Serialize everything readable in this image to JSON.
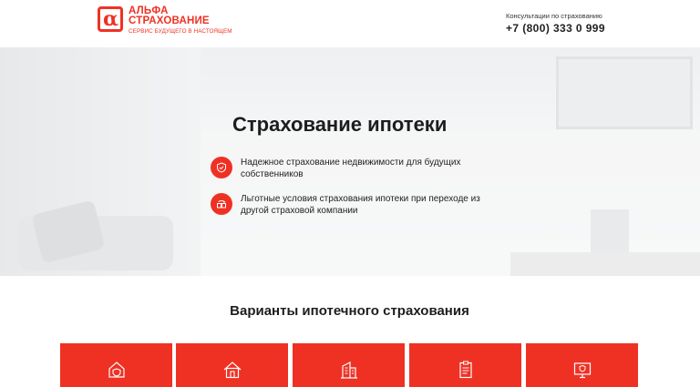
{
  "header": {
    "logo_line1": "АЛЬФА",
    "logo_line2": "СТРАХОВАНИЕ",
    "logo_tagline": "СЕРВИС БУДУЩЕГО В НАСТОЯЩЕМ",
    "contact_label": "Консультации по страхованию",
    "phone": "+7 (800) 333 0 999"
  },
  "hero": {
    "title": "Страхование ипотеки",
    "features": [
      {
        "icon": "shield-icon",
        "text": "Надежное страхование недвижимости для будущих собственников"
      },
      {
        "icon": "transfer-icon",
        "text": "Льготные условия страхования ипотеки при переходе из другой страховой компании"
      }
    ]
  },
  "variants": {
    "title": "Варианты ипотечного страхования",
    "tiles": [
      {
        "icon": "house-shield-icon"
      },
      {
        "icon": "house-icon"
      },
      {
        "icon": "building-icon"
      },
      {
        "icon": "document-icon"
      },
      {
        "icon": "monitor-shield-icon"
      }
    ]
  },
  "colors": {
    "brand": "#ef3124",
    "text": "#1d1d1d"
  }
}
